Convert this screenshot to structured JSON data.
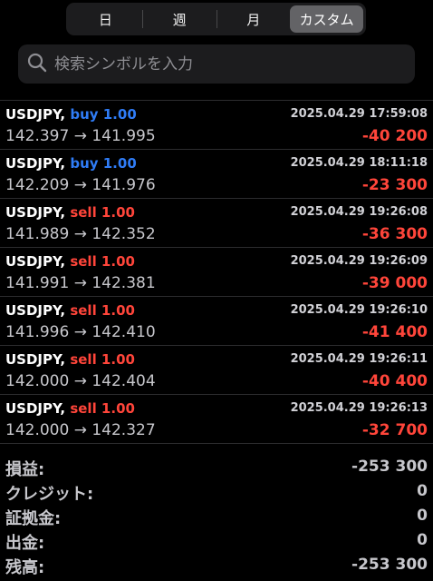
{
  "tabs": [
    {
      "label": "日",
      "active": false
    },
    {
      "label": "週",
      "active": false
    },
    {
      "label": "月",
      "active": false
    },
    {
      "label": "カスタム",
      "active": true
    }
  ],
  "search": {
    "placeholder": "検索シンボルを入力"
  },
  "trades": [
    {
      "symbol": "USDJPY,",
      "type": "buy 1.00",
      "side": "buy",
      "time": "2025.04.29 17:59:08",
      "prices": "142.397 → 141.995",
      "profit": "-40 200"
    },
    {
      "symbol": "USDJPY,",
      "type": "buy 1.00",
      "side": "buy",
      "time": "2025.04.29 18:11:18",
      "prices": "142.209 → 141.976",
      "profit": "-23 300"
    },
    {
      "symbol": "USDJPY,",
      "type": "sell 1.00",
      "side": "sell",
      "time": "2025.04.29 19:26:08",
      "prices": "141.989 → 142.352",
      "profit": "-36 300"
    },
    {
      "symbol": "USDJPY,",
      "type": "sell 1.00",
      "side": "sell",
      "time": "2025.04.29 19:26:09",
      "prices": "141.991 → 142.381",
      "profit": "-39 000"
    },
    {
      "symbol": "USDJPY,",
      "type": "sell 1.00",
      "side": "sell",
      "time": "2025.04.29 19:26:10",
      "prices": "141.996 → 142.410",
      "profit": "-41 400"
    },
    {
      "symbol": "USDJPY,",
      "type": "sell 1.00",
      "side": "sell",
      "time": "2025.04.29 19:26:11",
      "prices": "142.000 → 142.404",
      "profit": "-40 400"
    },
    {
      "symbol": "USDJPY,",
      "type": "sell 1.00",
      "side": "sell",
      "time": "2025.04.29 19:26:13",
      "prices": "142.000 → 142.327",
      "profit": "-32 700"
    }
  ],
  "summary": [
    {
      "label": "損益:",
      "value": "-253 300"
    },
    {
      "label": "クレジット:",
      "value": "0"
    },
    {
      "label": "証拠金:",
      "value": "0"
    },
    {
      "label": "出金:",
      "value": "0"
    },
    {
      "label": "残高:",
      "value": "-253 300"
    }
  ],
  "colors": {
    "buy": "#2f7cf6",
    "sell": "#ff453a",
    "loss": "#ff453a",
    "background": "#000000"
  }
}
